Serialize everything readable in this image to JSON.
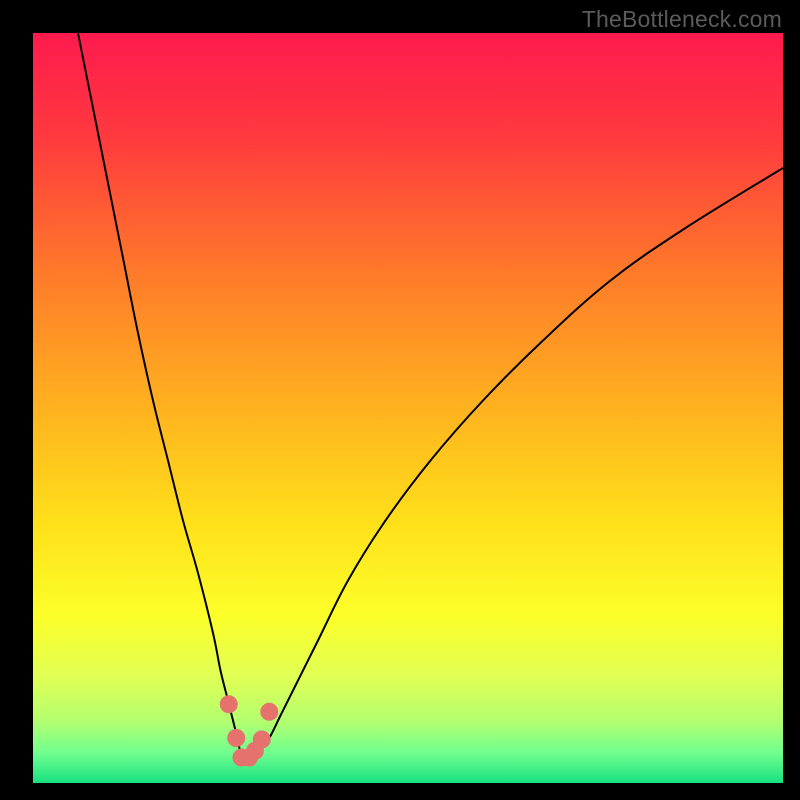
{
  "watermark": "TheBottleneck.com",
  "chart_data": {
    "type": "line",
    "title": "",
    "xlabel": "",
    "ylabel": "",
    "xlim": [
      0,
      100
    ],
    "ylim": [
      0,
      100
    ],
    "background_gradient": {
      "stops": [
        {
          "offset": 0.0,
          "color": "#ff1a4e"
        },
        {
          "offset": 0.14,
          "color": "#ff3a3e"
        },
        {
          "offset": 0.32,
          "color": "#ff7a2a"
        },
        {
          "offset": 0.5,
          "color": "#ffb21f"
        },
        {
          "offset": 0.66,
          "color": "#ffe21a"
        },
        {
          "offset": 0.78,
          "color": "#fbff2a"
        },
        {
          "offset": 0.86,
          "color": "#e0ff55"
        },
        {
          "offset": 0.92,
          "color": "#b0ff70"
        },
        {
          "offset": 0.96,
          "color": "#70ff90"
        },
        {
          "offset": 1.0,
          "color": "#18e080"
        }
      ]
    },
    "series": [
      {
        "name": "bottleneck-curve",
        "stroke": "#000000",
        "stroke_width": 2,
        "x": [
          6,
          8,
          10,
          12,
          14,
          16,
          18,
          20,
          22,
          24,
          25,
          26,
          27,
          27.7,
          28.3,
          29,
          30,
          31.5,
          33,
          35,
          38,
          42,
          47,
          53,
          60,
          68,
          77,
          87,
          100
        ],
        "y": [
          100,
          90,
          80,
          70,
          60,
          51,
          43,
          35,
          28,
          20,
          15,
          11,
          7,
          4,
          3,
          3.2,
          4,
          6,
          9,
          13,
          19,
          27,
          35,
          43,
          51,
          59,
          67,
          74,
          82
        ]
      }
    ],
    "markers": {
      "name": "highlight-dots",
      "fill": "#e5726c",
      "radius": 9,
      "points": [
        {
          "x": 26.1,
          "y": 10.5
        },
        {
          "x": 27.1,
          "y": 6.0
        },
        {
          "x": 27.8,
          "y": 3.4
        },
        {
          "x": 28.8,
          "y": 3.4
        },
        {
          "x": 29.6,
          "y": 4.3
        },
        {
          "x": 30.5,
          "y": 5.8
        },
        {
          "x": 31.5,
          "y": 9.5
        }
      ]
    }
  }
}
